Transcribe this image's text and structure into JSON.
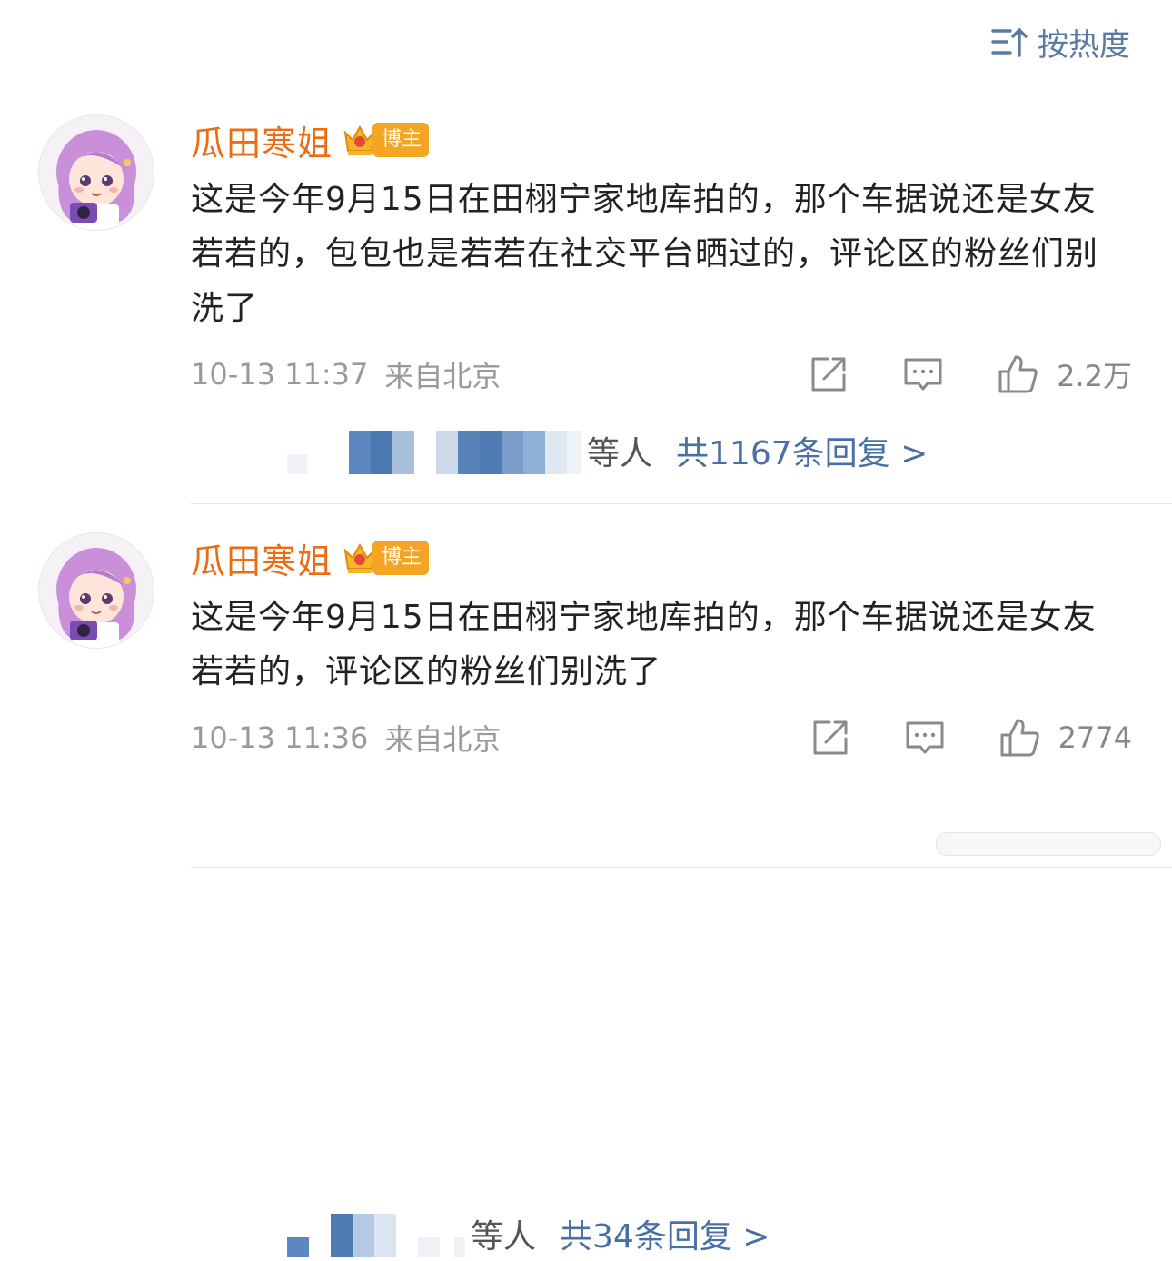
{
  "sort": {
    "label": "按热度"
  },
  "comments": [
    {
      "username": "瓜田寒姐",
      "badge": "博主",
      "text": "这是今年9月15日在田栩宁家地库拍的，那个车据说还是女友若若的，包包也是若若在社交平台晒过的，评论区的粉丝们别洗了",
      "time": "10-13 11:37",
      "location": "来自北京",
      "likes": "2.2万",
      "reply_others": "等人",
      "reply_count": "共1167条回复 >"
    },
    {
      "username": "瓜田寒姐",
      "badge": "博主",
      "text": "这是今年9月15日在田栩宁家地库拍的，那个车据说还是女友若若的，评论区的粉丝们别洗了",
      "time": "10-13 11:36",
      "location": "来自北京",
      "likes": "2774",
      "reply_others": "等人",
      "reply_count": "共34条回复 >"
    }
  ],
  "icons": {
    "sort": "sort-icon",
    "share": "share-icon",
    "comment": "comment-icon",
    "like": "like-icon"
  },
  "colors": {
    "username": "#ea6c13",
    "link": "#4a6fa5",
    "badge": "#f5a524",
    "meta": "#9a9a9a"
  }
}
